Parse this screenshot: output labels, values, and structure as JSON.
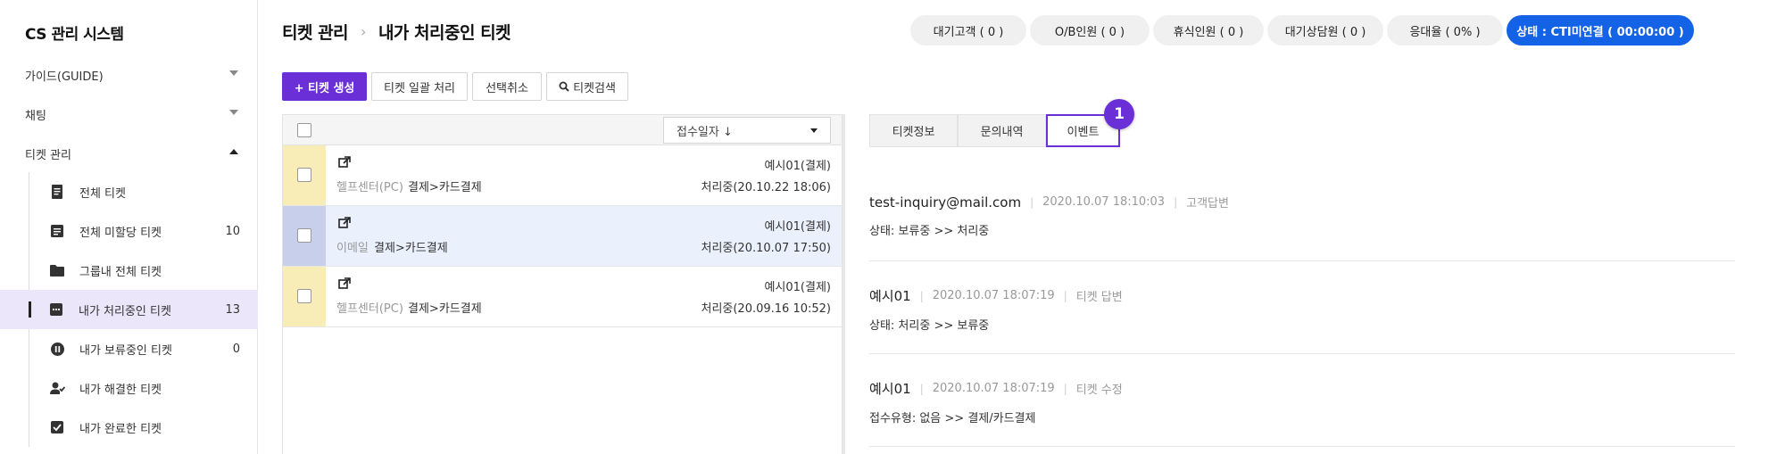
{
  "sidebar": {
    "title": "CS 관리 시스템",
    "menus": [
      {
        "label": "가이드(GUIDE)",
        "expanded": false
      },
      {
        "label": "채팅",
        "expanded": false
      },
      {
        "label": "티켓 관리",
        "expanded": true
      }
    ],
    "items": [
      {
        "label": "전체 티켓",
        "count": "",
        "icon": "ticket-list-icon"
      },
      {
        "label": "전체 미할당 티켓",
        "count": "10",
        "icon": "note-icon"
      },
      {
        "label": "그룹내 전체 티켓",
        "count": "",
        "icon": "folder-icon"
      },
      {
        "label": "내가 처리중인 티켓",
        "count": "13",
        "icon": "chat-dots-icon"
      },
      {
        "label": "내가 보류중인 티켓",
        "count": "0",
        "icon": "pause-icon"
      },
      {
        "label": "내가 해결한 티켓",
        "count": "",
        "icon": "user-check-icon"
      },
      {
        "label": "내가 완료한 티켓",
        "count": "",
        "icon": "checkbox-icon"
      }
    ]
  },
  "header": {
    "breadcrumb": [
      "티켓 관리",
      "내가 처리중인 티켓"
    ],
    "status": [
      {
        "label": "대기고객 ( 0 )"
      },
      {
        "label": "O/B인원 ( 0 )"
      },
      {
        "label": "휴식인원 ( 0 )"
      },
      {
        "label": "대기상담원 ( 0 )"
      },
      {
        "label": "응대율 ( 0% )"
      },
      {
        "label": "상태 : CTI미연결 ( 00:00:00 )"
      }
    ]
  },
  "toolbar": {
    "create": "+ 티켓 생성",
    "bulk": "티켓 일괄 처리",
    "deselect": "선택취소",
    "search": "티켓검색"
  },
  "list": {
    "sort_label": "접수일자 ↓",
    "tickets": [
      {
        "channel": "헬프센터(PC)",
        "category": "결제>카드결제",
        "assignee": "예시01(결제)",
        "status": "처리중(20.10.22 18:06)",
        "selected": false
      },
      {
        "channel": "이메일",
        "category": "결제>카드결제",
        "assignee": "예시01(결제)",
        "status": "처리중(20.10.07 17:50)",
        "selected": true
      },
      {
        "channel": "헬프센터(PC)",
        "category": "결제>카드결제",
        "assignee": "예시01(결제)",
        "status": "처리중(20.09.16 10:52)",
        "selected": false
      }
    ]
  },
  "detail": {
    "tabs": [
      "티켓정보",
      "문의내역",
      "이벤트"
    ],
    "active_tab": "이벤트",
    "badge": "1",
    "events": [
      {
        "author": "test-inquiry@mail.com",
        "time": "2020.10.07 18:10:03",
        "type": "고객답변",
        "change": "상태: 보류중 >> 처리중"
      },
      {
        "author": "예시01",
        "time": "2020.10.07 18:07:19",
        "type": "티켓 답변",
        "change": "상태: 처리중 >> 보류중"
      },
      {
        "author": "예시01",
        "time": "2020.10.07 18:07:19",
        "type": "티켓 수정",
        "change": "접수유형: 없음 >> 결제/카드결제"
      }
    ]
  },
  "colors": {
    "accent": "#6a2fd6",
    "cti": "#1463e6",
    "active_bg": "#ece6fb",
    "stripe": "#f8ecb7",
    "stripe_selected": "#c7cfeb",
    "selected_row": "#eaf1fd"
  }
}
